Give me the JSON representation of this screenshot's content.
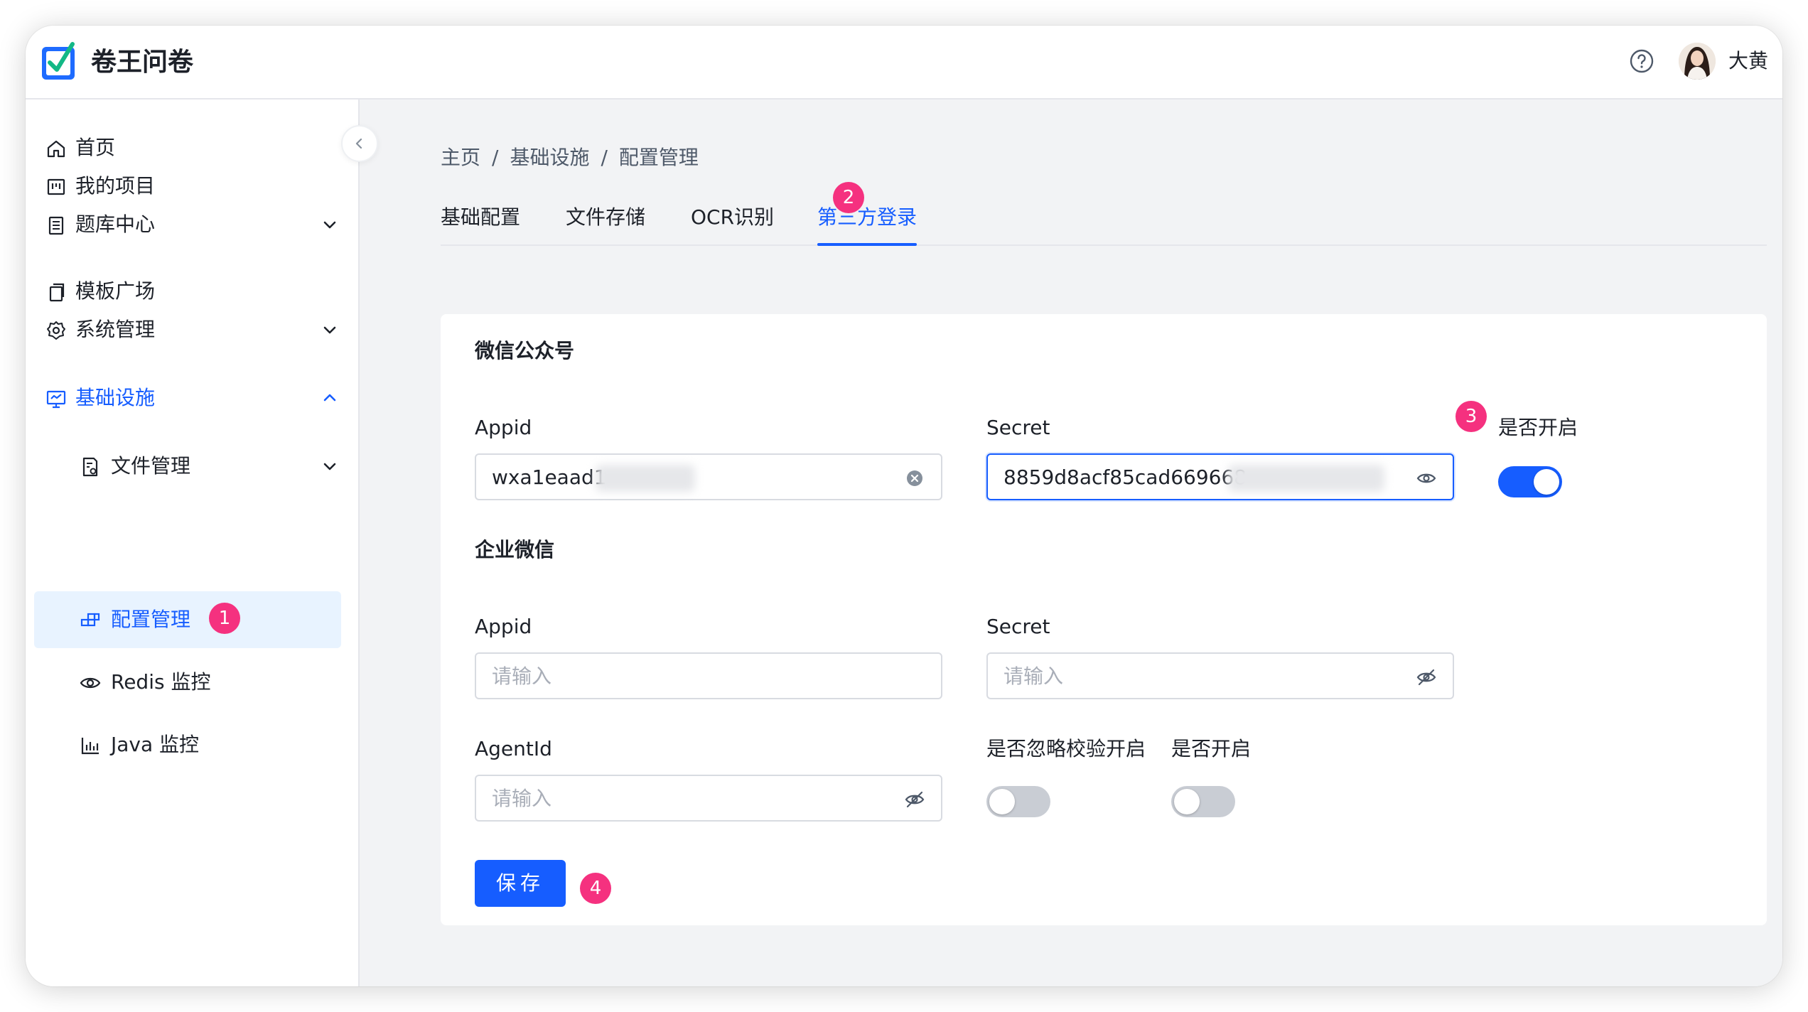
{
  "app": {
    "title": "卷王问卷"
  },
  "header": {
    "user_name": "大黄",
    "help_icon": "question-circle-icon"
  },
  "sidebar": {
    "items": [
      {
        "label": "首页",
        "icon": "home-icon"
      },
      {
        "label": "我的项目",
        "icon": "project-icon"
      },
      {
        "label": "题库中心",
        "icon": "book-icon"
      },
      {
        "label": "模板广场",
        "icon": "template-icon"
      },
      {
        "label": "系统管理",
        "icon": "gear-icon"
      },
      {
        "label": "基础设施",
        "icon": "monitor-icon"
      },
      {
        "label": "文件管理",
        "icon": "file-settings-icon"
      },
      {
        "label": "配置管理",
        "icon": "config-icon"
      },
      {
        "label": "Redis 监控",
        "icon": "eye-icon"
      },
      {
        "label": "Java 监控",
        "icon": "bar-chart-icon"
      }
    ]
  },
  "breadcrumb": [
    "主页",
    "基础设施",
    "配置管理"
  ],
  "tabs": [
    "基础配置",
    "文件存储",
    "OCR识别",
    "第三方登录"
  ],
  "active_tab": "第三方登录",
  "badges": [
    "1",
    "2",
    "3",
    "4"
  ],
  "wechat_mp": {
    "title": "微信公众号",
    "appid_label": "Appid",
    "appid_value": "wxa1eaad1",
    "secret_label": "Secret",
    "secret_value": "8859d8acf85cad669668",
    "enable_label": "是否开启",
    "enabled": true
  },
  "wecom": {
    "title": "企业微信",
    "appid_label": "Appid",
    "appid_placeholder": "请输入",
    "secret_label": "Secret",
    "secret_placeholder": "请输入",
    "agentid_label": "AgentId",
    "agentid_placeholder": "请输入",
    "ignore_verify_label": "是否忽略校验开启",
    "ignore_verify_enabled": false,
    "enable_label": "是否开启",
    "enabled": false
  },
  "save_label": "保存",
  "colors": {
    "primary": "#165dff",
    "badge": "#f5317f",
    "background": "#f2f3f5"
  }
}
